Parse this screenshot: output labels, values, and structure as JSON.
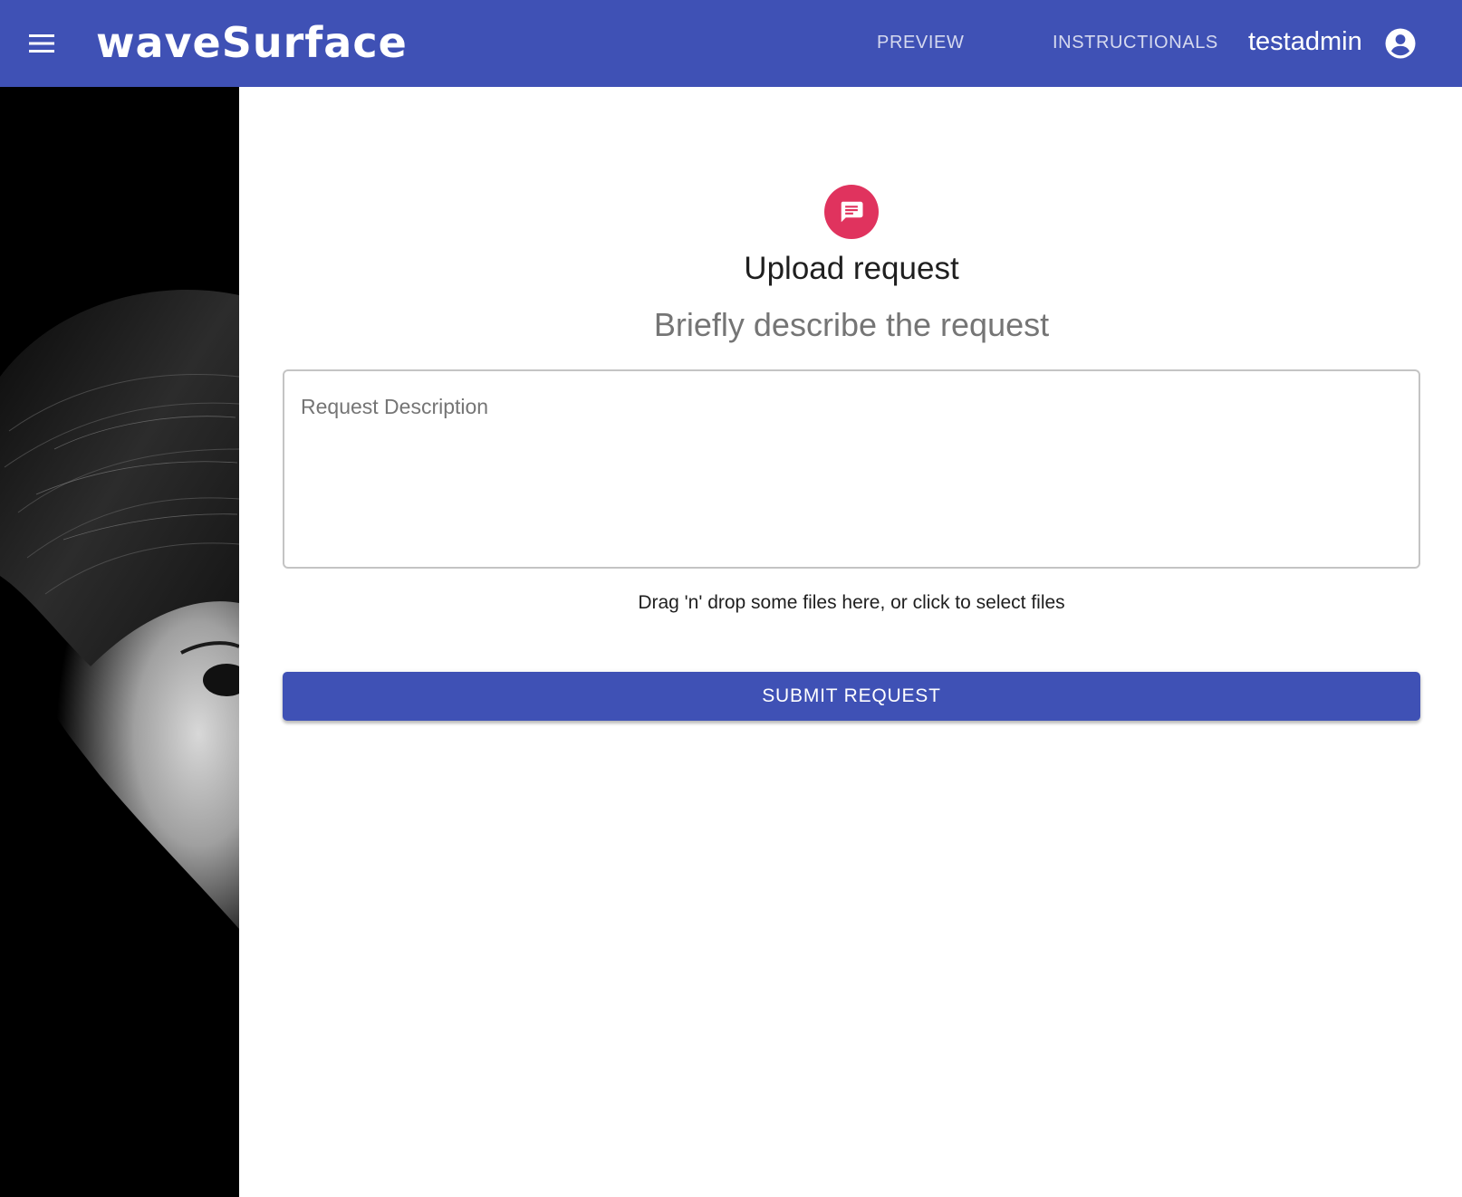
{
  "colors": {
    "primary": "#3f51b5",
    "avatar_accent": "#e0335e"
  },
  "appbar": {
    "menu_icon": "hamburger-menu-icon",
    "logo_text": "waveSurface",
    "nav": {
      "preview": "PREVIEW",
      "instructionals": "INSTRUCTIONALS"
    },
    "username": "testadmin",
    "account_icon": "account-circle-icon"
  },
  "form": {
    "avatar_icon": "chat-message-icon",
    "title": "Upload request",
    "subtitle": "Briefly describe the request",
    "description": {
      "placeholder": "Request Description",
      "value": ""
    },
    "dropzone_text": "Drag 'n' drop some files here, or click to select files",
    "submit_label": "SUBMIT REQUEST"
  }
}
